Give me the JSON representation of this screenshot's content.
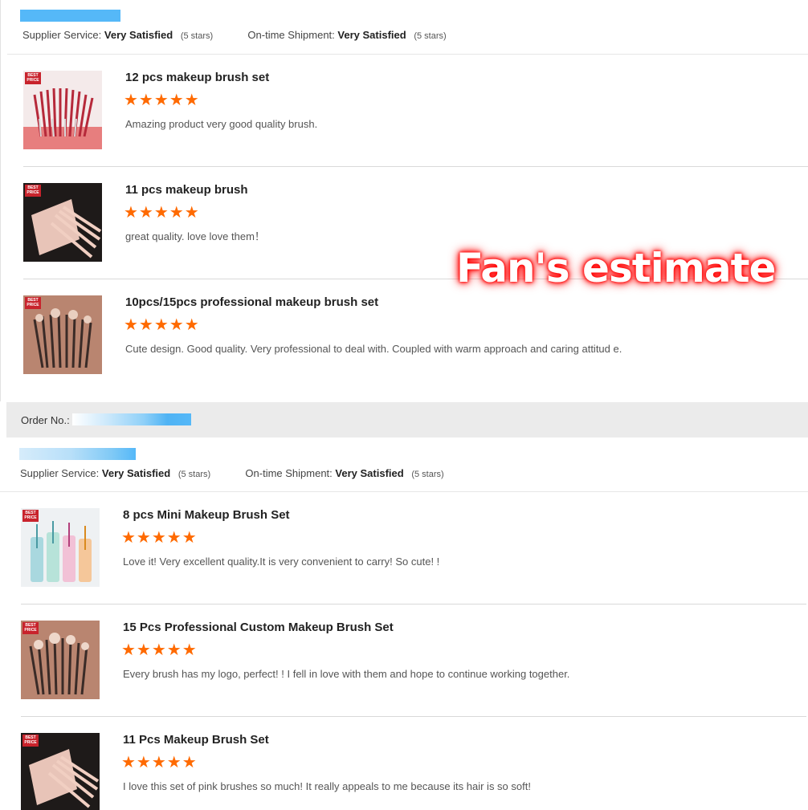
{
  "ratings": {
    "supplier_label": "Supplier Service:",
    "supplier_value": "Very Satisfied",
    "supplier_stars": "(5 stars)",
    "shipment_label": "On-time Shipment:",
    "shipment_value": "Very Satisfied",
    "shipment_stars": "(5 stars)"
  },
  "order": {
    "label": "Order No.:"
  },
  "watermark": "Fan's estimate",
  "colors": {
    "star": "#ff6a00",
    "redaction": "#4db3f5",
    "badge": "#c8232c"
  },
  "order1": {
    "reviews": [
      {
        "title": "12 pcs makeup brush set",
        "stars": "★★★★★",
        "rating": 5,
        "comment": "Amazing product very good quality brush.",
        "badge": "BEST PRICE"
      },
      {
        "title": "11 pcs makeup brush",
        "stars": "★★★★★",
        "rating": 5,
        "comment": "great quality. love love them！",
        "badge": "BEST PRICE"
      },
      {
        "title": "10pcs/15pcs professional makeup brush set",
        "stars": "★★★★★",
        "rating": 5,
        "comment": "Cute design. Good quality. Very professional to deal with. Coupled with warm approach and caring attitud e.",
        "badge": "BEST PRICE"
      }
    ]
  },
  "order2": {
    "reviews": [
      {
        "title": "8 pcs Mini Makeup Brush Set",
        "stars": "★★★★★",
        "rating": 5,
        "comment": "Love it! Very excellent quality.It is very convenient to carry! So cute! !",
        "badge": "BEST PRICE"
      },
      {
        "title": "15 Pcs Professional Custom Makeup Brush Set",
        "stars": "★★★★★",
        "rating": 5,
        "comment": "Every brush has my logo, perfect! ! I fell in love with them and hope to continue working together.",
        "badge": "BEST PRICE"
      },
      {
        "title": "11 Pcs Makeup Brush Set",
        "stars": "★★★★★",
        "rating": 5,
        "comment": "I love this set of pink brushes so much! It really appeals to me because its hair is so soft!",
        "badge": "BEST PRICE"
      }
    ]
  }
}
